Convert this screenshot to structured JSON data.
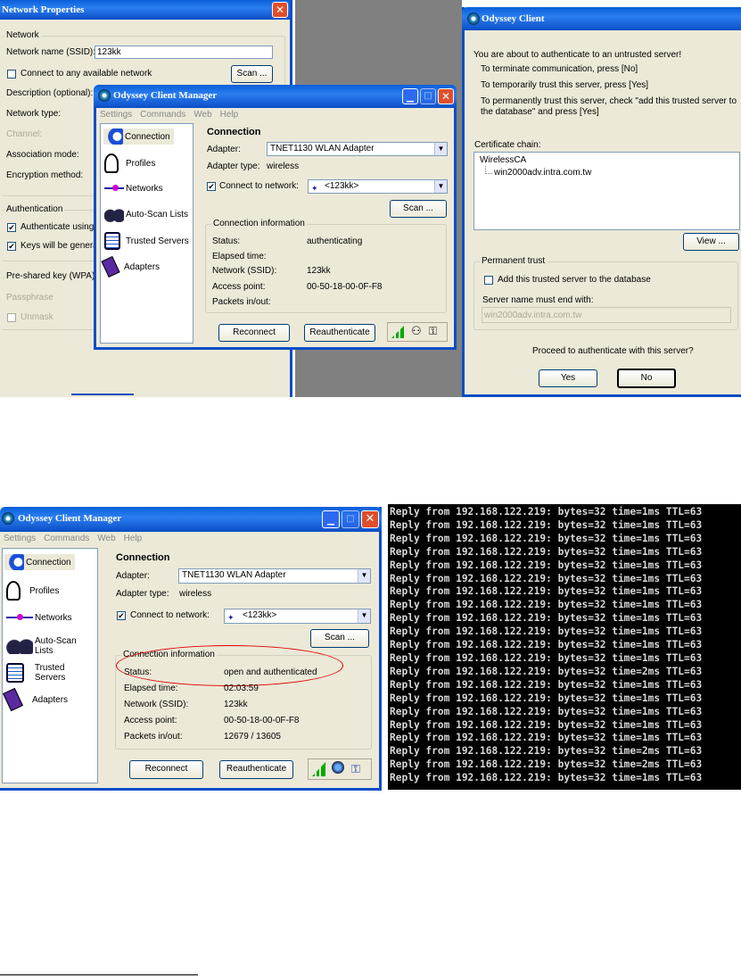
{
  "net_props": {
    "title": "Network Properties",
    "network_group": "Network",
    "ssid_label": "Network name (SSID):",
    "ssid_value": "123kk",
    "connect_any": "Connect to any available network",
    "scan": "Scan ...",
    "description": "Description (optional):",
    "network_type": "Network type:",
    "channel": "Channel:",
    "association": "Association mode:",
    "encryption": "Encryption method:",
    "auth_group": "Authentication",
    "auth_using": "Authenticate using p",
    "keys_generated": "Keys will be generat",
    "psk_group": "Pre-shared key (WPA)",
    "passphrase": "Passphrase",
    "unmask": "Unmask"
  },
  "ocm1": {
    "title": "Odyssey Client Manager",
    "menu": [
      "Settings",
      "Commands",
      "Web",
      "Help"
    ],
    "sidebar": [
      "Connection",
      "Profiles",
      "Networks",
      "Auto-Scan Lists",
      "Trusted Servers",
      "Adapters"
    ],
    "heading": "Connection",
    "adapter_label": "Adapter:",
    "adapter_value": "TNET1130 WLAN Adapter",
    "adapter_type_label": "Adapter type:",
    "adapter_type_value": "wireless",
    "connect_network_label": "Connect to network:",
    "network_value": "<123kk>",
    "scan": "Scan ...",
    "info_group": "Connection information",
    "status_label": "Status:",
    "status_value": "authenticating",
    "elapsed_label": "Elapsed time:",
    "elapsed_value": "",
    "ssid_label": "Network (SSID):",
    "ssid_value": "123kk",
    "ap_label": "Access point:",
    "ap_value": "00-50-18-00-0F-F8",
    "packets_label": "Packets in/out:",
    "packets_value": "",
    "reconnect": "Reconnect",
    "reauth": "Reauthenticate"
  },
  "trust": {
    "title": "Odyssey Client",
    "line1": "You are about to authenticate to an untrusted server!",
    "line2": "To terminate communication, press [No]",
    "line3": "To temporarily trust this server, press [Yes]",
    "line4a": "To permanently trust this server, check \"add this trusted server to",
    "line4b": "the database\" and press [Yes]",
    "chain_label": "Certificate chain:",
    "chain_root": "WirelessCA",
    "chain_child": "win2000adv.intra.com.tw",
    "view": "View ...",
    "perm_group": "Permanent trust",
    "add_label": "Add this trusted server to the database",
    "name_end_label": "Server name must end with:",
    "name_end_value": "win2000adv.intra.com.tw",
    "question": "Proceed to authenticate with this server?",
    "yes": "Yes",
    "no": "No"
  },
  "ocm2": {
    "title": "Odyssey Client Manager",
    "menu": [
      "Settings",
      "Commands",
      "Web",
      "Help"
    ],
    "sidebar": [
      "Connection",
      "Profiles",
      "Networks",
      "Auto-Scan Lists",
      "Trusted Servers",
      "Adapters"
    ],
    "heading": "Connection",
    "adapter_label": "Adapter:",
    "adapter_value": "TNET1130 WLAN Adapter",
    "adapter_type_label": "Adapter type:",
    "adapter_type_value": "wireless",
    "connect_network_label": "Connect to network:",
    "network_value": "<123kk>",
    "scan": "Scan ...",
    "info_group": "Connection information",
    "status_label": "Status:",
    "status_value": "open and authenticated",
    "elapsed_label": "Elapsed time:",
    "elapsed_value": "02:03:59",
    "ssid_label": "Network (SSID):",
    "ssid_value": "123kk",
    "ap_label": "Access point:",
    "ap_value": "00-50-18-00-0F-F8",
    "packets_label": "Packets in/out:",
    "packets_value": "12679 / 13605",
    "reconnect": "Reconnect",
    "reauth": "Reauthenticate"
  },
  "terminal": {
    "lines": [
      "Reply from 192.168.122.219: bytes=32 time=1ms TTL=63",
      "Reply from 192.168.122.219: bytes=32 time=1ms TTL=63",
      "Reply from 192.168.122.219: bytes=32 time=1ms TTL=63",
      "Reply from 192.168.122.219: bytes=32 time=1ms TTL=63",
      "Reply from 192.168.122.219: bytes=32 time=1ms TTL=63",
      "Reply from 192.168.122.219: bytes=32 time=1ms TTL=63",
      "Reply from 192.168.122.219: bytes=32 time=1ms TTL=63",
      "Reply from 192.168.122.219: bytes=32 time=1ms TTL=63",
      "Reply from 192.168.122.219: bytes=32 time=1ms TTL=63",
      "Reply from 192.168.122.219: bytes=32 time=1ms TTL=63",
      "Reply from 192.168.122.219: bytes=32 time=1ms TTL=63",
      "Reply from 192.168.122.219: bytes=32 time=1ms TTL=63",
      "Reply from 192.168.122.219: bytes=32 time=2ms TTL=63",
      "Reply from 192.168.122.219: bytes=32 time=1ms TTL=63",
      "Reply from 192.168.122.219: bytes=32 time=1ms TTL=63",
      "Reply from 192.168.122.219: bytes=32 time=1ms TTL=63",
      "Reply from 192.168.122.219: bytes=32 time=1ms TTL=63",
      "Reply from 192.168.122.219: bytes=32 time=1ms TTL=63",
      "Reply from 192.168.122.219: bytes=32 time=2ms TTL=63",
      "Reply from 192.168.122.219: bytes=32 time=2ms TTL=63",
      "Reply from 192.168.122.219: bytes=32 time=1ms TTL=63",
      "Reply from 192.168.122.219: bytes=32 time=1ms TTL=63"
    ]
  }
}
